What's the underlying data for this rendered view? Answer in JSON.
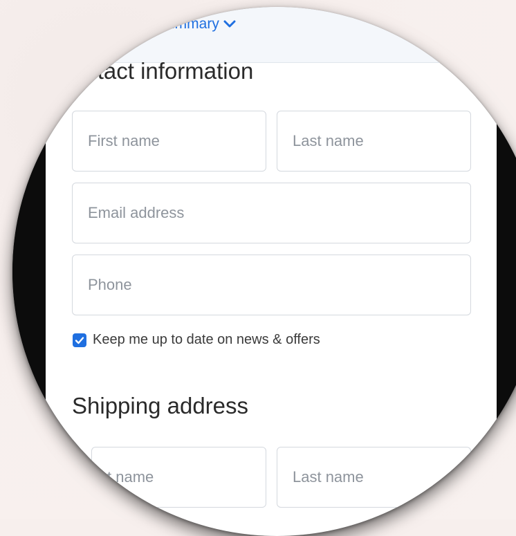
{
  "order_summary": {
    "label": "ummary",
    "icon": "chevron-down-icon"
  },
  "contact": {
    "title": "ontact information",
    "first_name_placeholder": "First name",
    "last_name_placeholder": "Last name",
    "email_placeholder": "Email address",
    "phone_placeholder": "Phone",
    "newsletter_label": "Keep me up to date on news & offers",
    "newsletter_checked": true
  },
  "shipping": {
    "title": "Shipping address",
    "first_name_placeholder": "t name",
    "last_name_placeholder": "Last name"
  },
  "colors": {
    "accent": "#1f6fe0",
    "border": "#d4d8de",
    "placeholder": "#8e949c"
  }
}
